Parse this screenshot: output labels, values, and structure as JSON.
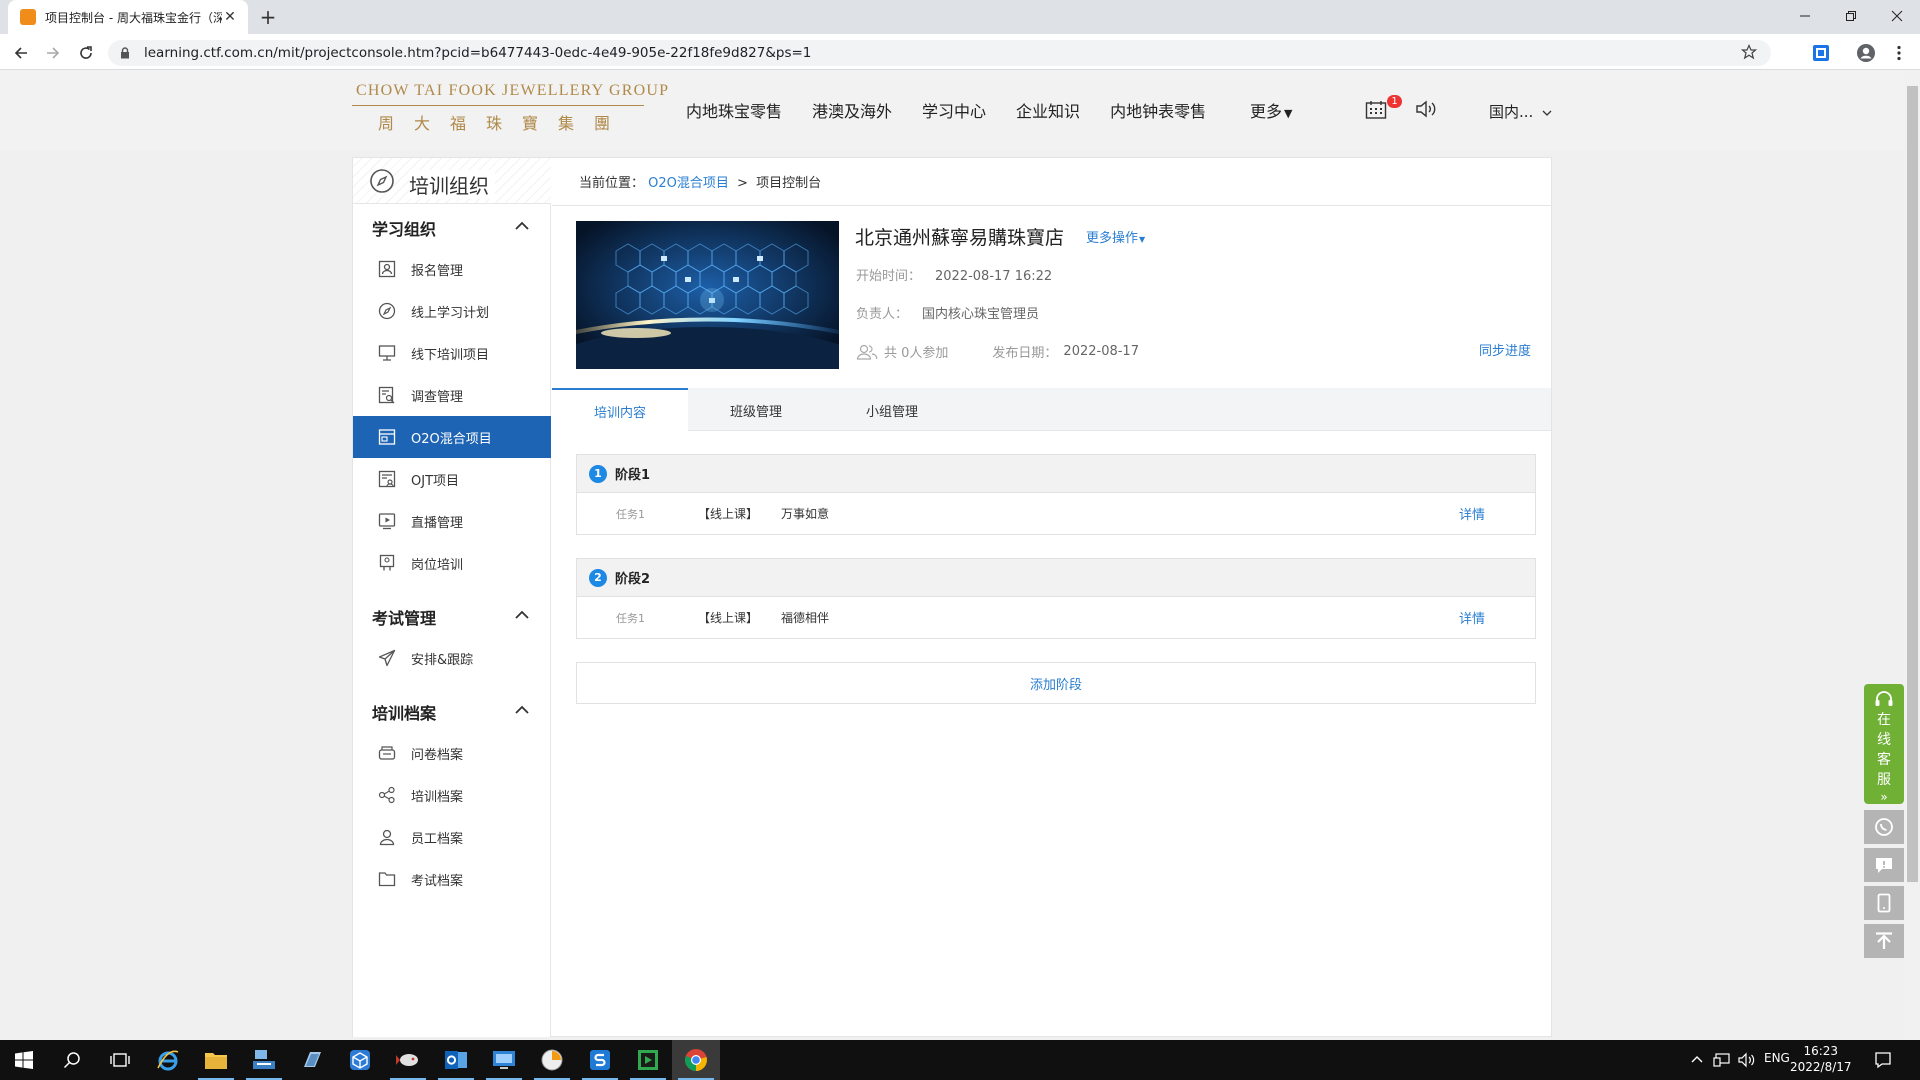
{
  "browser": {
    "tab_title": "项目控制台 - 周大福珠宝金行（深",
    "url": "learning.ctf.com.cn/mit/projectconsole.htm?pcid=b6477443-0edc-4e49-905e-22f18fe9d827&ps=1"
  },
  "site": {
    "logo_en": "CHOW TAI FOOK JEWELLERY GROUP",
    "logo_cn": "周大福珠寶集團",
    "nav": [
      "内地珠宝零售",
      "港澳及海外",
      "学习中心",
      "企业知识",
      "内地钟表零售"
    ],
    "more": "更多",
    "badge_count": "1",
    "region": "国内..."
  },
  "sidebar": {
    "title": "培训组织",
    "groups": [
      {
        "title": "学习组织",
        "items": [
          {
            "label": "报名管理",
            "icon": "signup-icon"
          },
          {
            "label": "线上学习计划",
            "icon": "compass-icon"
          },
          {
            "label": "线下培训项目",
            "icon": "presentation-icon"
          },
          {
            "label": "调查管理",
            "icon": "survey-icon"
          },
          {
            "label": "O2O混合项目",
            "icon": "o2o-icon",
            "active": true
          },
          {
            "label": "OJT项目",
            "icon": "ojt-icon"
          },
          {
            "label": "直播管理",
            "icon": "live-icon"
          },
          {
            "label": "岗位培训",
            "icon": "post-training-icon"
          }
        ]
      },
      {
        "title": "考试管理",
        "items": [
          {
            "label": "安排&跟踪",
            "icon": "send-icon"
          }
        ]
      },
      {
        "title": "培训档案",
        "items": [
          {
            "label": "问卷档案",
            "icon": "questionnaire-icon"
          },
          {
            "label": "培训档案",
            "icon": "share-icon"
          },
          {
            "label": "员工档案",
            "icon": "user-icon"
          },
          {
            "label": "考试档案",
            "icon": "folder-icon"
          }
        ]
      }
    ]
  },
  "breadcrumb": {
    "prefix": "当前位置：",
    "link": "O2O混合项目",
    "sep": ">",
    "current": "项目控制台"
  },
  "project": {
    "title": "北京通州蘇寧易購珠寶店",
    "more_ops": "更多操作",
    "start_label": "开始时间：",
    "start_value": "2022-08-17 16:22",
    "owner_label": "负责人：",
    "owner_value": "国内核心珠宝管理员",
    "participants": "共 0人参加",
    "publish_label": "发布日期：",
    "publish_value": "2022-08-17",
    "sync": "同步进度"
  },
  "tabs": [
    "培训内容",
    "班级管理",
    "小组管理"
  ],
  "stages": [
    {
      "num": "1",
      "name": "阶段1",
      "tasks": [
        {
          "label": "任务1",
          "type": "【线上课】",
          "name": "万事如意",
          "action": "详情"
        }
      ]
    },
    {
      "num": "2",
      "name": "阶段2",
      "tasks": [
        {
          "label": "任务1",
          "type": "【线上课】",
          "name": "福德相伴",
          "action": "详情"
        }
      ]
    }
  ],
  "add_stage": "添加阶段",
  "service": {
    "label": "在线客服",
    "chars": [
      "在",
      "线",
      "客",
      "服"
    ],
    "arrow": "»"
  },
  "taskbar": {
    "lang": "ENG",
    "time": "16:23",
    "date": "2022/8/17"
  },
  "colors": {
    "accent": "#1e64b4",
    "link": "#2a7ed2",
    "gold": "#b08a4a",
    "service": "#6fb035"
  }
}
